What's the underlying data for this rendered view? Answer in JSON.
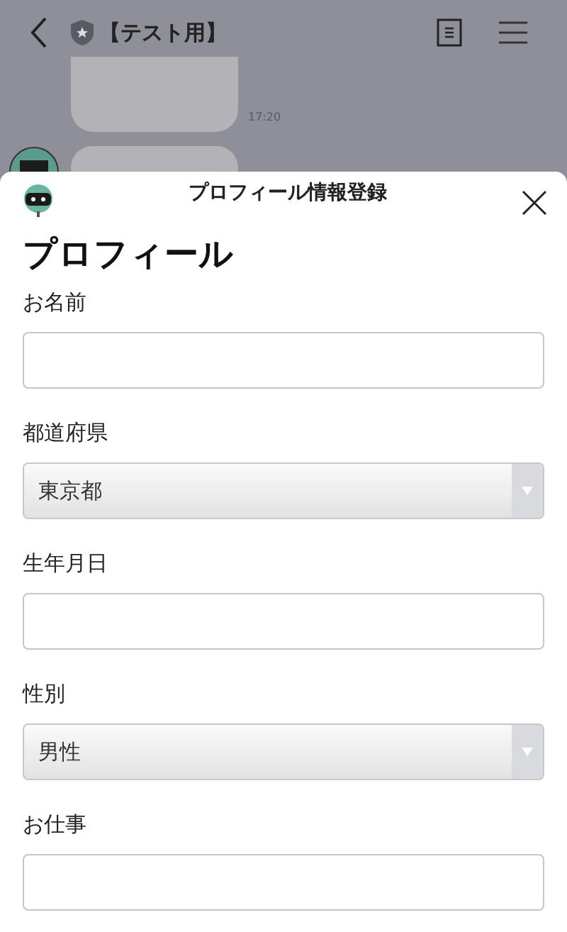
{
  "chat_header": {
    "title": "【テスト用】"
  },
  "messages": [
    {
      "time": "17:20"
    }
  ],
  "sheet": {
    "title": "プロフィール情報登録",
    "heading": "プロフィール",
    "fields": [
      {
        "label": "お名前",
        "kind": "text"
      },
      {
        "label": "都道府県",
        "kind": "select",
        "value": "東京都"
      },
      {
        "label": "生年月日",
        "kind": "text"
      },
      {
        "label": "性別",
        "kind": "select",
        "value": "男性"
      },
      {
        "label": "お仕事",
        "kind": "text"
      }
    ]
  }
}
